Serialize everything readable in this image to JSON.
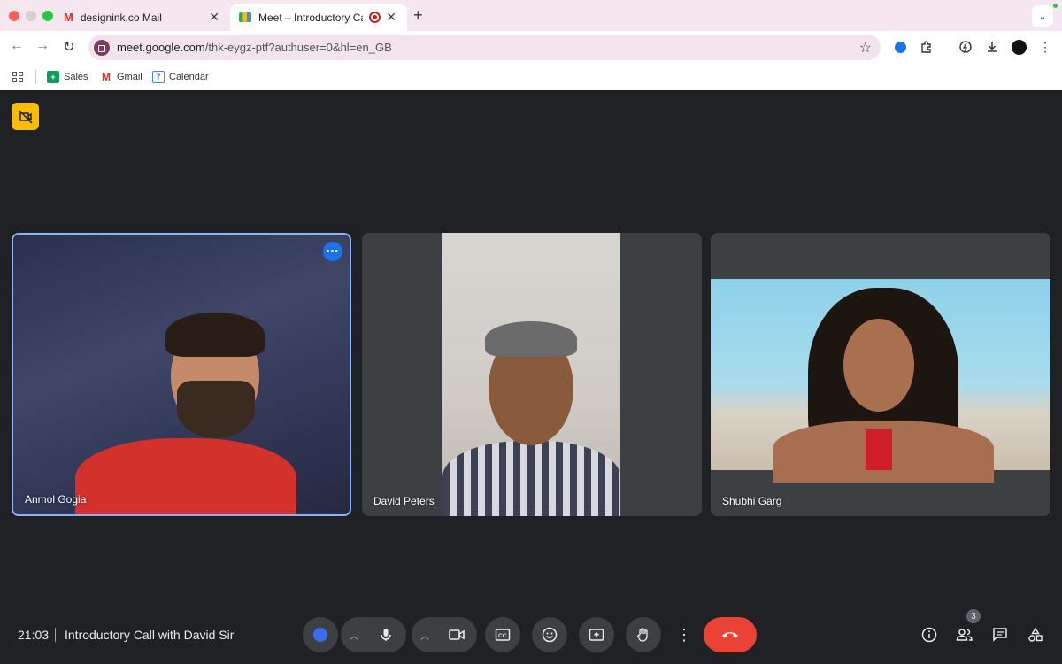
{
  "browser": {
    "tabs": [
      {
        "label": "designink.co Mail",
        "icon": "gmail-icon",
        "active": false
      },
      {
        "label": "Meet – Introductory Call w",
        "icon": "meet-icon",
        "active": true,
        "recording": true
      }
    ],
    "url_host": "meet.google.com",
    "url_path": "/thk-eygz-ptf?authuser=0&hl=en_GB",
    "bookmarks": [
      {
        "label": "Sales",
        "icon": "sheets-icon"
      },
      {
        "label": "Gmail",
        "icon": "gmail-icon"
      },
      {
        "label": "Calendar",
        "icon": "calendar-icon"
      }
    ]
  },
  "meeting": {
    "time": "21:03",
    "title": "Introductory Call with David Sir",
    "participant_count": "3",
    "participants": [
      {
        "name": "Anmol Gogia",
        "active_speaker": true
      },
      {
        "name": "David Peters",
        "active_speaker": false
      },
      {
        "name": "Shubhi Garg",
        "active_speaker": false
      }
    ]
  },
  "colors": {
    "stage_bg": "#202124",
    "tile_bg": "#3c4043",
    "end_call": "#ea4335",
    "active_border": "#8ab4f8",
    "chrome_pink": "#f6e6ef"
  }
}
